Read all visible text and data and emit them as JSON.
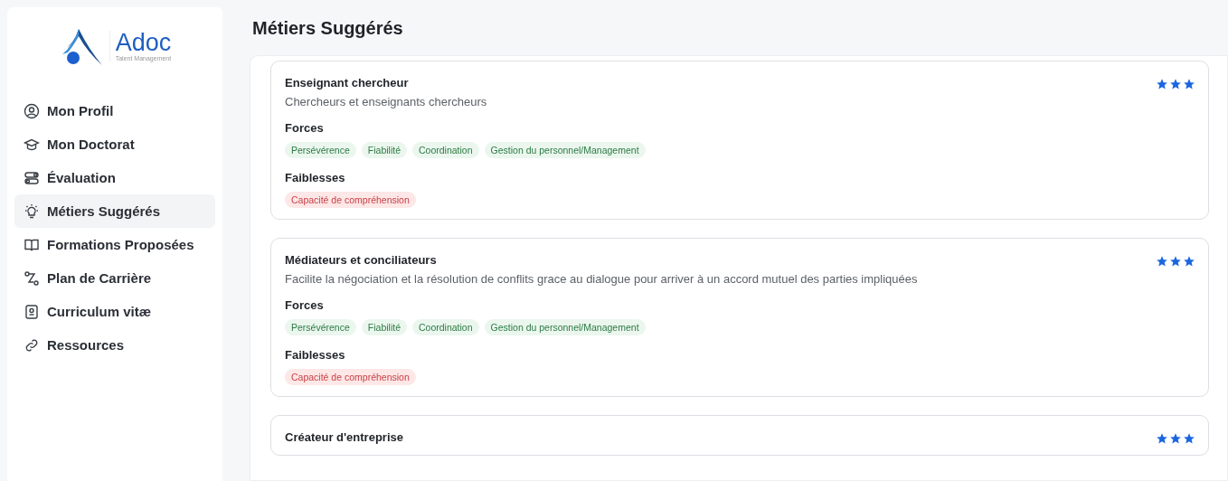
{
  "sidebar": {
    "logo": {
      "name": "Adoc",
      "tagline": "Talent Management"
    },
    "items": [
      {
        "label": "Mon Profil",
        "selected": false
      },
      {
        "label": "Mon Doctorat",
        "selected": false
      },
      {
        "label": "Évaluation",
        "selected": false
      },
      {
        "label": "Métiers Suggérés",
        "selected": true
      },
      {
        "label": "Formations Proposées",
        "selected": false
      },
      {
        "label": "Plan de Carrière",
        "selected": false
      },
      {
        "label": "Curriculum vitæ",
        "selected": false
      },
      {
        "label": "Ressources",
        "selected": false
      }
    ]
  },
  "page": {
    "title": "Métiers Suggérés"
  },
  "jobs": [
    {
      "title": "Enseignant chercheur",
      "description": "Chercheurs et enseignants chercheurs",
      "stars": 3,
      "strengths_label": "Forces",
      "strengths": [
        "Persévérence",
        "Fiabilité",
        "Coordination",
        "Gestion du personnel/Management"
      ],
      "weaknesses_label": "Faiblesses",
      "weaknesses": [
        "Capacité de compréhension"
      ]
    },
    {
      "title": "Médiateurs et conciliateurs",
      "description": "Facilite la négociation et la résolution de conflits grace au dialogue pour arriver à un accord mutuel des parties impliquées",
      "stars": 3,
      "strengths_label": "Forces",
      "strengths": [
        "Persévérence",
        "Fiabilité",
        "Coordination",
        "Gestion du personnel/Management"
      ],
      "weaknesses_label": "Faiblesses",
      "weaknesses": [
        "Capacité de compréhension"
      ]
    },
    {
      "title": "Créateur d'entreprise",
      "stars": 3
    }
  ]
}
